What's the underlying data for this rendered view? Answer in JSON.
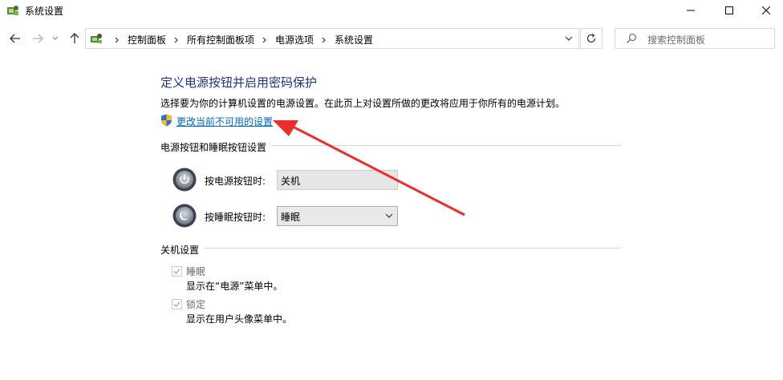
{
  "window": {
    "title": "系统设置"
  },
  "address": {
    "crumbs": [
      "控制面板",
      "所有控制面板项",
      "电源选项",
      "系统设置"
    ]
  },
  "search": {
    "placeholder": "搜索控制面板"
  },
  "main": {
    "title": "定义电源按钮并启用密码保护",
    "description": "选择要为你的计算机设置的电源设置。在此页上对设置所做的更改将应用于你所有的电源计划。",
    "change_link": "更改当前不可用的设置"
  },
  "buttons_section": {
    "heading": "电源按钮和睡眠按钮设置",
    "power": {
      "label": "按电源按钮时:",
      "value": "关机"
    },
    "sleep": {
      "label": "按睡眠按钮时:",
      "value": "睡眠"
    }
  },
  "shutdown_section": {
    "heading": "关机设置",
    "items": [
      {
        "label": "睡眠",
        "description": "显示在“电源”菜单中。",
        "checked": true
      },
      {
        "label": "锁定",
        "description": "显示在用户头像菜单中。",
        "checked": true
      }
    ]
  },
  "colors": {
    "title": "#1e3287",
    "link": "#0066cc",
    "annotation": "#ee2c2c"
  },
  "icons": [
    "app-icon",
    "back-arrow-icon",
    "forward-arrow-icon",
    "chevron-down-icon",
    "up-arrow-icon",
    "control-panel-icon",
    "refresh-icon",
    "search-icon",
    "shield-icon",
    "power-icon",
    "sleep-icon",
    "checkmark-icon"
  ]
}
